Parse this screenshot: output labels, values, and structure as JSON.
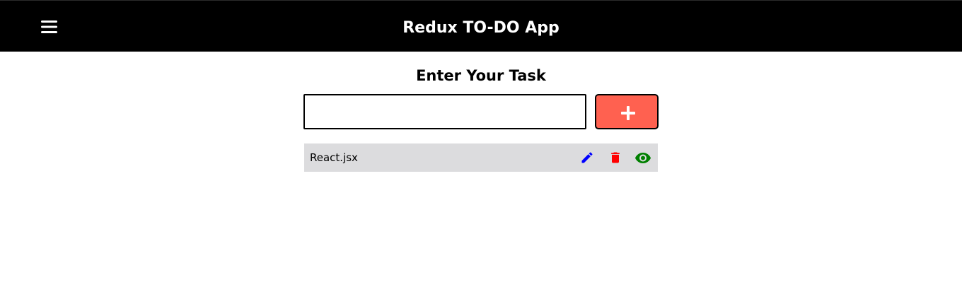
{
  "header": {
    "title": "Redux TO-DO App",
    "menu_icon": "hamburger-menu-icon"
  },
  "main": {
    "heading": "Enter Your Task",
    "task_input": {
      "value": "",
      "placeholder": ""
    },
    "add_button": {
      "icon": "plus-icon",
      "color": "#ff6150"
    },
    "tasks": [
      {
        "title": "React.jsx",
        "actions": [
          {
            "icon": "edit-pencil-icon",
            "color": "#0000ff"
          },
          {
            "icon": "delete-trash-icon",
            "color": "#ff0000"
          },
          {
            "icon": "view-eye-icon",
            "color": "#008000"
          }
        ]
      }
    ]
  }
}
